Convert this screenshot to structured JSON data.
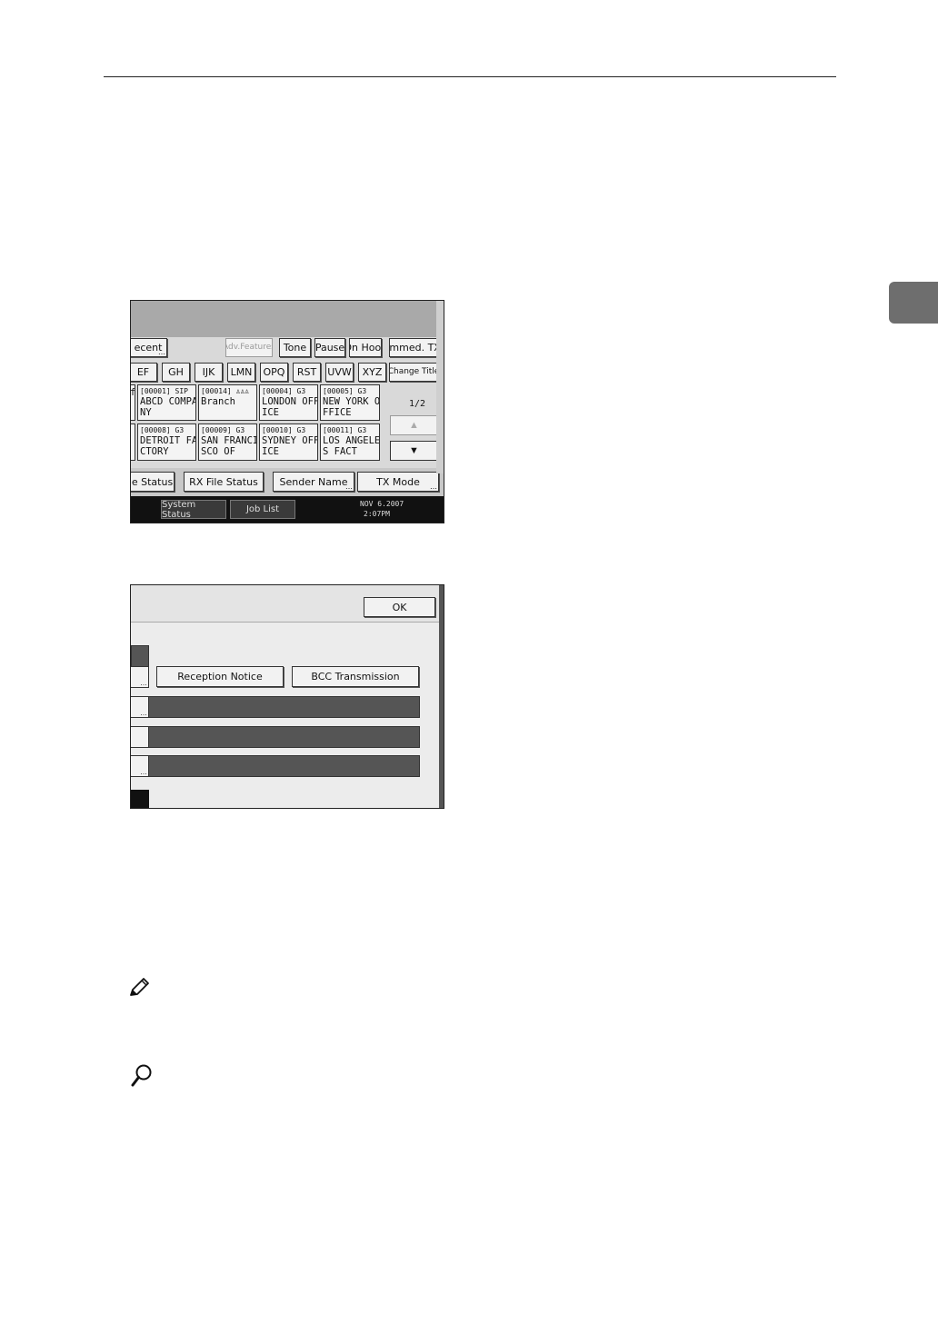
{
  "screen1": {
    "row1": [
      "ecent",
      "Adv.Features",
      "Tone",
      "Pause",
      "On Hook",
      "Immed. TX"
    ],
    "row2": [
      "EF",
      "GH",
      "IJK",
      "LMN",
      "OPQ",
      "RST",
      "UVW",
      "XYZ",
      "Change Title"
    ],
    "left_stub_top": "f",
    "destinations": [
      {
        "code": "[00001] SIP",
        "name": "ABCD COMPA\nNY"
      },
      {
        "code": "[00014] ♙♙♙",
        "name": "Branch"
      },
      {
        "code": "[00004] G3",
        "name": "LONDON OFF\nICE"
      },
      {
        "code": "[00005] G3",
        "name": "NEW YORK O\nFFICE"
      },
      {
        "code": "[00008] G3",
        "name": "DETROIT FA\nCTORY"
      },
      {
        "code": "[00009] G3",
        "name": "SAN FRANCI\nSCO OF"
      },
      {
        "code": "[00010] G3",
        "name": "SYDNEY OFF\nICE"
      },
      {
        "code": "[00011] G3",
        "name": "LOS ANGELE\nS FACT"
      }
    ],
    "page_indicator": "1/2",
    "scroll_up": "▲",
    "scroll_down": "▼",
    "bottom_buttons": [
      "le Status",
      "RX File Status",
      "Sender Name",
      "TX Mode"
    ],
    "status_buttons": [
      "System Status",
      "Job List"
    ],
    "date": "NOV   6.2007",
    "time": "2:07PM"
  },
  "screen2": {
    "ok_label": "OK",
    "reception_notice_label": "Reception Notice",
    "bcc_transmission_label": "BCC Transmission"
  },
  "icons": {
    "note": "pencil-icon",
    "reference": "magnifier-icon"
  }
}
